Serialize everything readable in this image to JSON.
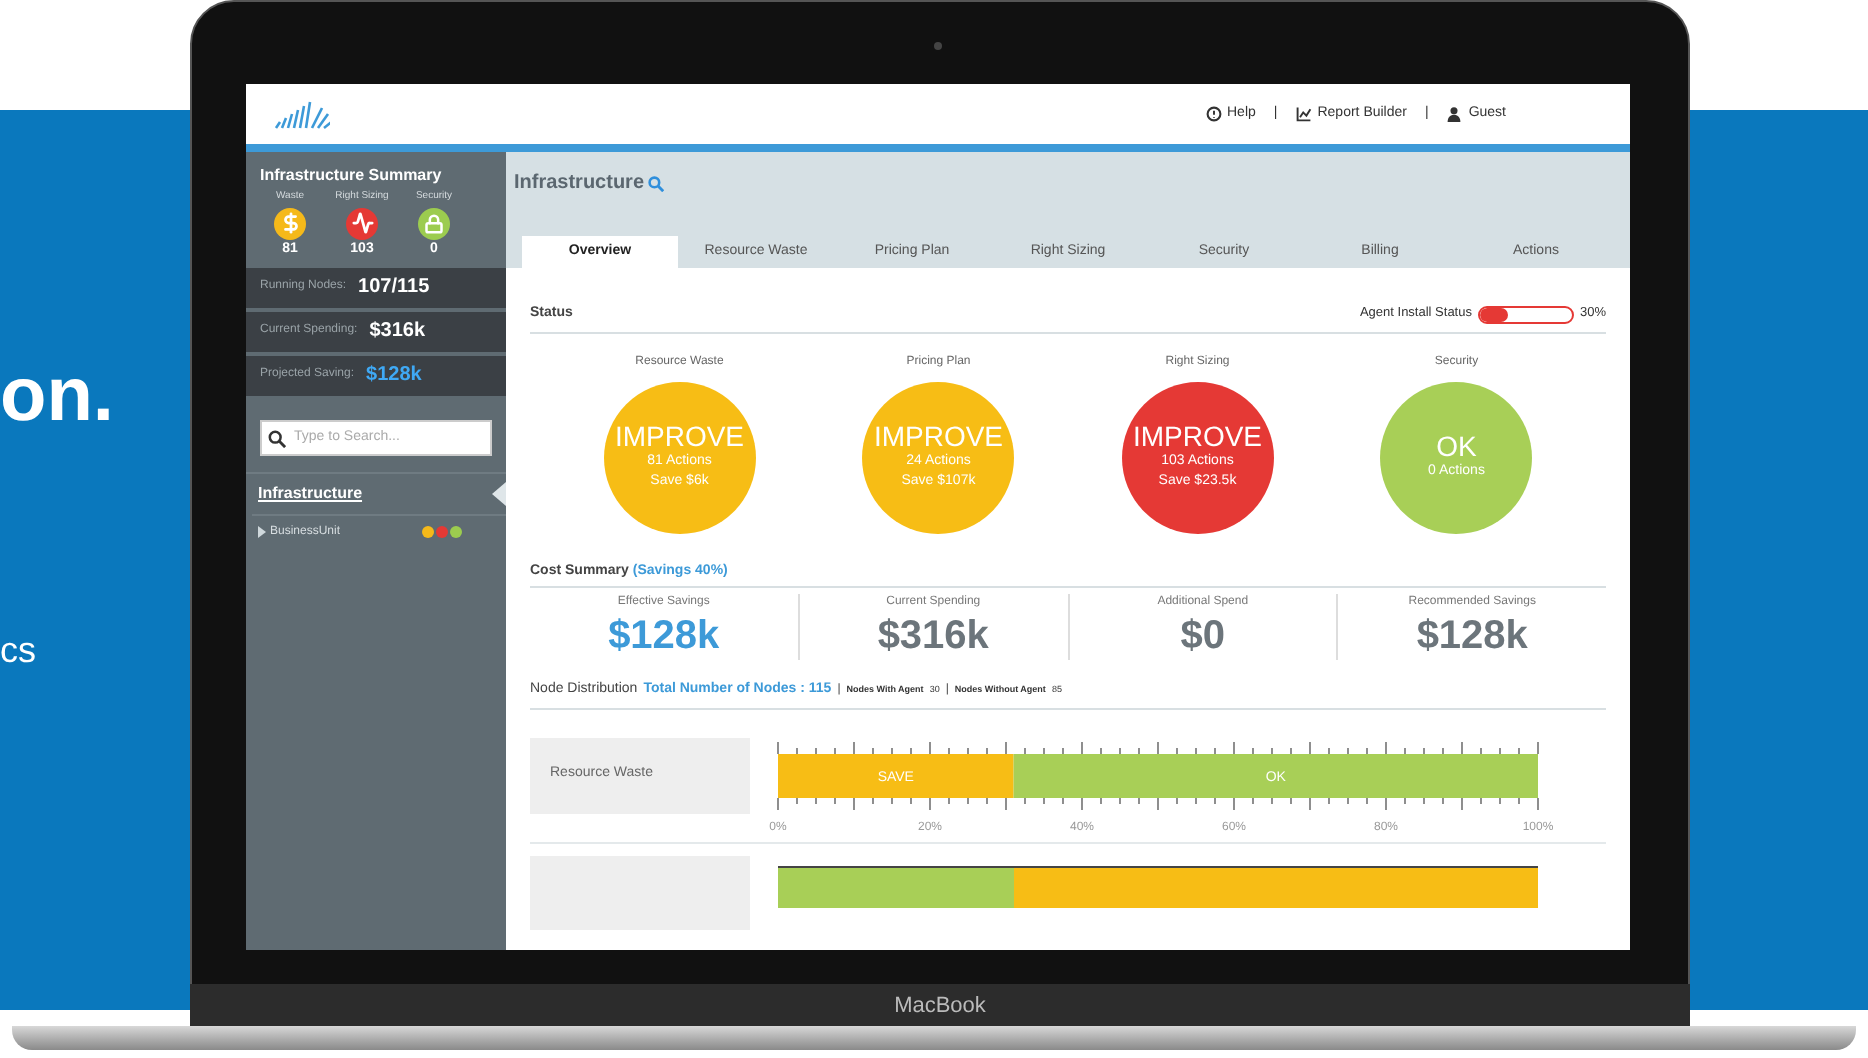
{
  "backdrop": {
    "headline": "on.",
    "subtext": "cs"
  },
  "laptop": {
    "brand": "MacBook"
  },
  "header": {
    "nav": [
      {
        "kind": "help",
        "label": "Help"
      },
      {
        "kind": "separator",
        "label": "|"
      },
      {
        "kind": "report",
        "label": "Report Builder"
      },
      {
        "kind": "separator",
        "label": "|"
      },
      {
        "kind": "user",
        "label": "Guest"
      }
    ]
  },
  "sidebar": {
    "title": "Infrastructure Summary",
    "summary": [
      {
        "label": "Waste",
        "value": "81",
        "kind": "dollar",
        "color": "#f5b91a"
      },
      {
        "label": "Right Sizing",
        "value": "103",
        "kind": "pulse",
        "color": "#e53935"
      },
      {
        "label": "Security",
        "value": "0",
        "kind": "lock",
        "color": "#9ccc4f"
      }
    ],
    "stats": [
      {
        "label": "Running Nodes:",
        "value": "107/115",
        "highlight": false
      },
      {
        "label": "Current Spending:",
        "value": "$316k",
        "highlight": false
      },
      {
        "label": "Projected Saving:",
        "value": "$128k",
        "highlight": true
      }
    ],
    "search": {
      "placeholder": "Type to Search..."
    },
    "tree": [
      {
        "label": "Infrastructure",
        "selected": true,
        "children": [
          {
            "label": "BusinessUnit",
            "selected": false,
            "expanded": false,
            "badges": [
              {
                "color": "#f5b91a"
              },
              {
                "color": "#e53935"
              },
              {
                "color": "#9ccc4f"
              }
            ]
          }
        ]
      }
    ]
  },
  "main": {
    "title": "Infrastructure",
    "tabs": [
      {
        "label": "Overview",
        "selected": true
      },
      {
        "label": "Resource Waste",
        "selected": false
      },
      {
        "label": "Pricing Plan",
        "selected": false
      },
      {
        "label": "Right Sizing",
        "selected": false
      },
      {
        "label": "Security",
        "selected": false
      },
      {
        "label": "Billing",
        "selected": false
      },
      {
        "label": "Actions",
        "selected": false
      }
    ],
    "status": {
      "title": "Status",
      "agent_label": "Agent Install Status",
      "level": 0.3,
      "reading": "30%",
      "cards": [
        {
          "label": "Resource Waste",
          "verdict": "IMPROVE",
          "actions": "81 Actions",
          "save": "Save $6k",
          "color": "#f7bd15"
        },
        {
          "label": "Pricing Plan",
          "verdict": "IMPROVE",
          "actions": "24 Actions",
          "save": "Save $107k",
          "color": "#f7bd15"
        },
        {
          "label": "Right Sizing",
          "verdict": "IMPROVE",
          "actions": "103 Actions",
          "save": "Save $23.5k",
          "color": "#e53935"
        },
        {
          "label": "Security",
          "verdict": "OK",
          "actions": "0 Actions",
          "color": "#a8cf57"
        }
      ]
    },
    "cost": {
      "title": "Cost Summary",
      "note": "(Savings 40%)",
      "items": [
        {
          "label": "Effective Savings",
          "value": "$128k",
          "highlight": true
        },
        {
          "label": "Current Spending",
          "value": "$316k",
          "highlight": false
        },
        {
          "label": "Additional Spend",
          "value": "$0",
          "highlight": false
        },
        {
          "label": "Recommended Savings",
          "value": "$128k",
          "highlight": false
        }
      ]
    },
    "nodes": {
      "title": "Node Distribution",
      "total": "Total Number of Nodes : 115",
      "separator": "|",
      "with_label": "Nodes With Agent",
      "with_value": "30",
      "without_label": "Nodes Without Agent",
      "without_value": "85",
      "chart_data": {
        "type": "bar",
        "orientation": "horizontal",
        "stacked": true,
        "categories": [
          "Resource Waste"
        ],
        "series": [
          {
            "name": "SAVE",
            "color": "#f7bd15",
            "values": [
              31
            ]
          },
          {
            "name": "OK",
            "color": "#a8cf57",
            "values": [
              69
            ]
          }
        ],
        "xlim": [
          0,
          100
        ],
        "xticks": [
          {
            "value": 0,
            "label": "0%"
          },
          {
            "value": 20,
            "label": "20%"
          },
          {
            "value": 40,
            "label": "40%"
          },
          {
            "value": 60,
            "label": "60%"
          },
          {
            "value": 80,
            "label": "80%"
          },
          {
            "value": 100,
            "label": "100%"
          }
        ]
      },
      "partial_row": {
        "level": 0.31
      }
    }
  }
}
